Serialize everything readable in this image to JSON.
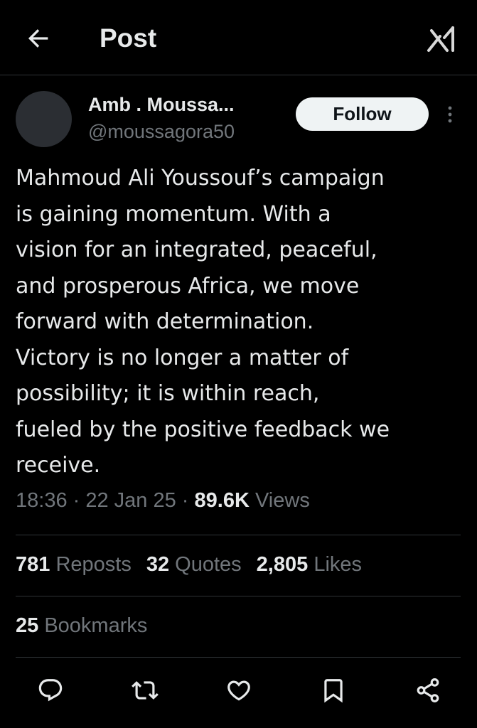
{
  "header": {
    "title": "Post",
    "back_icon": "arrow-left-icon",
    "grok_icon": "grok-icon"
  },
  "author": {
    "name": "Amb . Moussa...",
    "handle": "@moussagora50",
    "follow_label": "Follow",
    "more_icon": "more-vertical-icon"
  },
  "post": {
    "text": "Mahmoud Ali Youssouf’s campaign\nis gaining momentum. With a\nvision for an integrated, peaceful,\nand prosperous Africa, we move\nforward with determination.\nVictory is no longer a matter of\npossibility; it is within reach,\nfueled by the positive feedback we\nreceive.",
    "time": "18:36",
    "sep1": " · ",
    "date": "22 Jan 25",
    "sep2": " · ",
    "views_count": "89.6K",
    "views_label": "Views"
  },
  "stats": {
    "reposts_count": "781",
    "reposts_label": "Reposts",
    "quotes_count": "32",
    "quotes_label": "Quotes",
    "likes_count": "2,805",
    "likes_label": "Likes",
    "bookmarks_count": "25",
    "bookmarks_label": "Bookmarks"
  },
  "actions": [
    {
      "name": "reply-icon"
    },
    {
      "name": "repost-icon"
    },
    {
      "name": "like-icon"
    },
    {
      "name": "bookmark-icon"
    },
    {
      "name": "share-icon"
    }
  ],
  "colors": {
    "background": "#000000",
    "text_primary": "#e7e9ea",
    "text_secondary": "#71767b",
    "divider": "#2f3336",
    "follow_bg": "#eff3f4"
  }
}
